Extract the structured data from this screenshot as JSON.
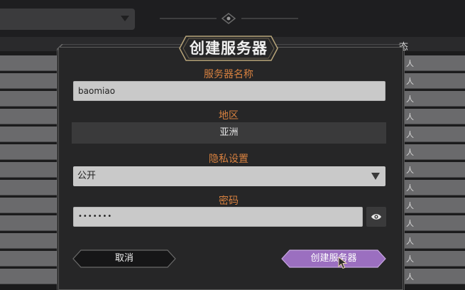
{
  "background": {
    "status_header": "态"
  },
  "dialog": {
    "title": "创建服务器",
    "server_name": {
      "label": "服务器名称",
      "value": "baomiao"
    },
    "region": {
      "label": "地区",
      "value": "亚洲"
    },
    "privacy": {
      "label": "隐私设置",
      "selected": "公开"
    },
    "password": {
      "label": "密码",
      "masked_value": "•••••••"
    },
    "buttons": {
      "cancel": "取消",
      "create": "创建服务器"
    }
  },
  "colors": {
    "label_orange": "#d6803f",
    "create_button_purple": "#9b6fc0",
    "dialog_background": "#262627",
    "input_background": "#c9c9c9"
  },
  "icons": {
    "privacy_dropdown": "caret-down-icon",
    "password_toggle": "eye-icon",
    "background_dropdown": "caret-down-icon"
  }
}
